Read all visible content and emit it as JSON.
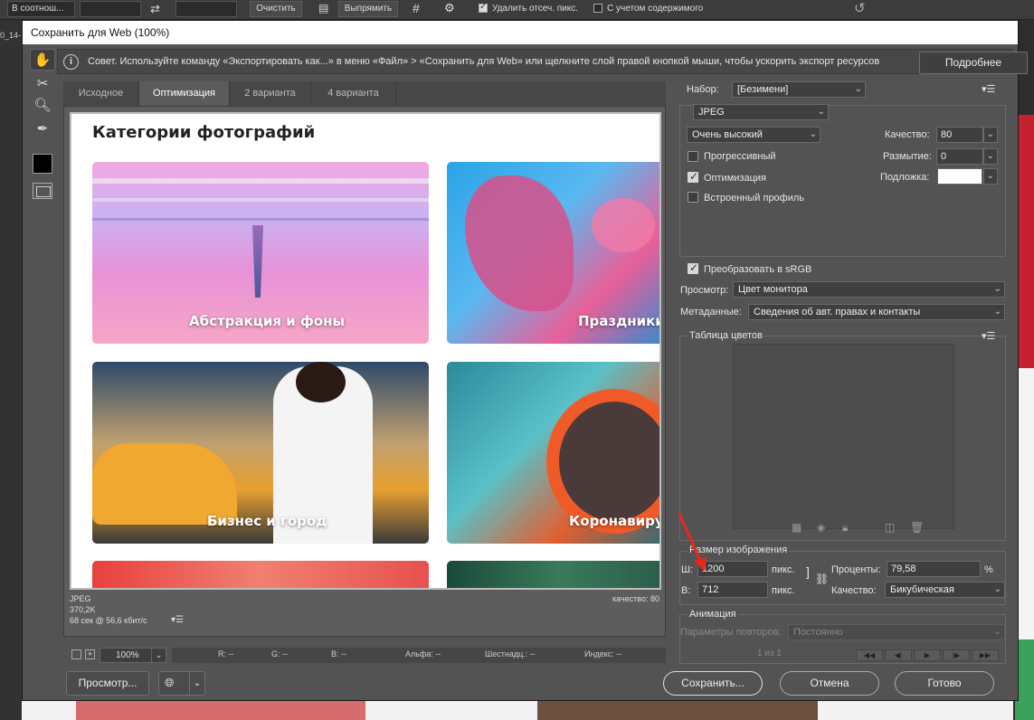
{
  "ps": {
    "optbar": {
      "resample": "В соотнош...",
      "clear": "Очистить",
      "straighten": "Выпрямить",
      "delete_cropped": "Удалить отсеч. пикс.",
      "content_aware": "С учетом содержимого"
    },
    "doc_tab": "0_14-"
  },
  "dialog": {
    "title": "Сохранить для Web (100%)",
    "tip": "Совет. Используйте команду «Экспортировать как...» в меню «Файл» > «Сохранить для Web» или щелкните слой правой кнопкой мыши, чтобы ускорить экспорт ресурсов",
    "more_button": "Подробнее",
    "tabs": [
      "Исходное",
      "Оптимизация",
      "2 варианта",
      "4 варианта"
    ],
    "canvas": {
      "title": "Категории фотографий",
      "cards": [
        "Абстракция и фоны",
        "Праздники",
        "Бизнес и город",
        "Коронавирус"
      ]
    },
    "info": {
      "format": "JPEG",
      "size": "370,2K",
      "time": "68 сек @ 56,6 кбит/с",
      "quality": "качество: 80"
    },
    "status": {
      "zoom": "100%",
      "r": "R: --",
      "g": "G: --",
      "b": "B: --",
      "alpha": "Альфа: --",
      "hex": "Шестнадц.: --",
      "index": "Индекс: --"
    },
    "buttons": {
      "preview": "Просмотр...",
      "save": "Сохранить...",
      "cancel": "Отмена",
      "done": "Готово"
    }
  },
  "settings": {
    "preset_label": "Набор:",
    "preset_value": "[Безимени]",
    "format": "JPEG",
    "quality_preset": "Очень высокий",
    "progressive": "Прогрессивный",
    "optimized": "Оптимизация",
    "embed_profile": "Встроенный профиль",
    "quality_label": "Качество:",
    "quality_value": "80",
    "blur_label": "Размытие:",
    "blur_value": "0",
    "matte_label": "Подложка:",
    "convert_srgb": "Преобразовать в sRGB",
    "preview_label": "Просмотр:",
    "preview_value": "Цвет монитора",
    "metadata_label": "Метаданные:",
    "metadata_value": "Сведения об авт. правах и контакты",
    "color_table": "Таблица цветов",
    "image_size": "Размер изображения",
    "w_label": "Ш:",
    "w_value": "1200",
    "h_label": "В:",
    "h_value": "712",
    "px": "пикс.",
    "percent_label": "Проценты:",
    "percent_value": "79,58",
    "percent_sign": "%",
    "resample_label": "Качество:",
    "resample_value": "Бикубическая",
    "animation": "Анимация",
    "loop_label": "Параметры повторов:",
    "loop_value": "Постоянно",
    "frame": "1 из 1"
  },
  "colors": {
    "accent_arrow": "#e8281c"
  }
}
